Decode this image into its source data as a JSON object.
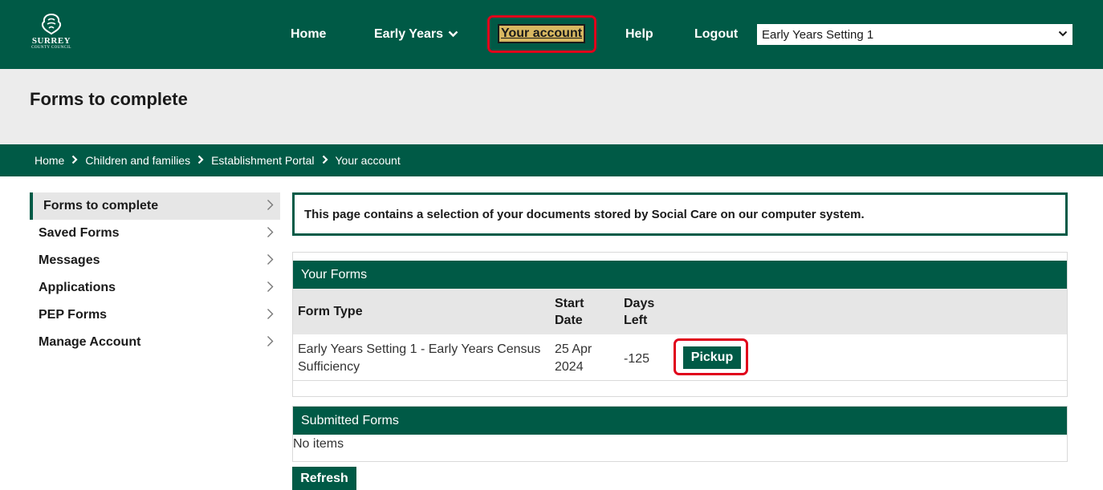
{
  "header": {
    "logo": {
      "text": "SURREY",
      "subtext": "COUNTY COUNCIL"
    },
    "nav": {
      "home": "Home",
      "early_years": "Early Years",
      "your_account": "Your account",
      "help": "Help",
      "logout": "Logout"
    },
    "setting_select": {
      "value": "Early Years Setting 1"
    }
  },
  "page_title": "Forms to complete",
  "breadcrumb": [
    "Home",
    "Children and families",
    "Establishment Portal",
    "Your account"
  ],
  "sidebar": {
    "items": [
      {
        "label": "Forms to complete",
        "active": true
      },
      {
        "label": "Saved Forms"
      },
      {
        "label": "Messages"
      },
      {
        "label": "Applications"
      },
      {
        "label": "PEP Forms"
      },
      {
        "label": "Manage Account"
      }
    ]
  },
  "info_text": "This page contains a selection of your documents stored by Social Care on our computer system.",
  "your_forms": {
    "title": "Your Forms",
    "columns": {
      "type": "Form Type",
      "start_date": "Start Date",
      "days_left": "Days Left"
    },
    "rows": [
      {
        "type": "Early Years Setting 1 - Early Years Census Sufficiency",
        "start_date": "25 Apr 2024",
        "days_left": "-125",
        "action": "Pickup"
      }
    ]
  },
  "submitted_forms": {
    "title": "Submitted Forms",
    "empty_text": "No items"
  },
  "refresh_label": "Refresh",
  "colors": {
    "brand_green": "#005a46",
    "highlight_red": "#e0001b",
    "focus_gold": "#d8b861"
  }
}
